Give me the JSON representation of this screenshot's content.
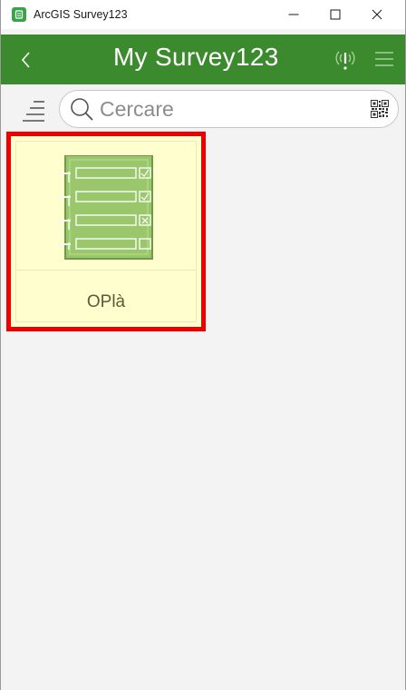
{
  "window": {
    "title": "ArcGIS Survey123",
    "controls": {
      "minimize": "—",
      "maximize": "☐",
      "close": "✕"
    }
  },
  "header": {
    "title": "My Survey123",
    "icons": [
      "back-icon",
      "gps-warning-icon",
      "menu-icon"
    ],
    "color": "#3c8a2e"
  },
  "search": {
    "placeholder": "Cercare",
    "value": "",
    "icons": [
      "sort-icon",
      "search-icon",
      "qr-code-icon"
    ]
  },
  "surveys": [
    {
      "title": "OPlà",
      "selected": true
    }
  ],
  "colors": {
    "tile_background": "#fefece",
    "highlight_border": "#ee0000",
    "thumbnail": "#9bc76c"
  }
}
